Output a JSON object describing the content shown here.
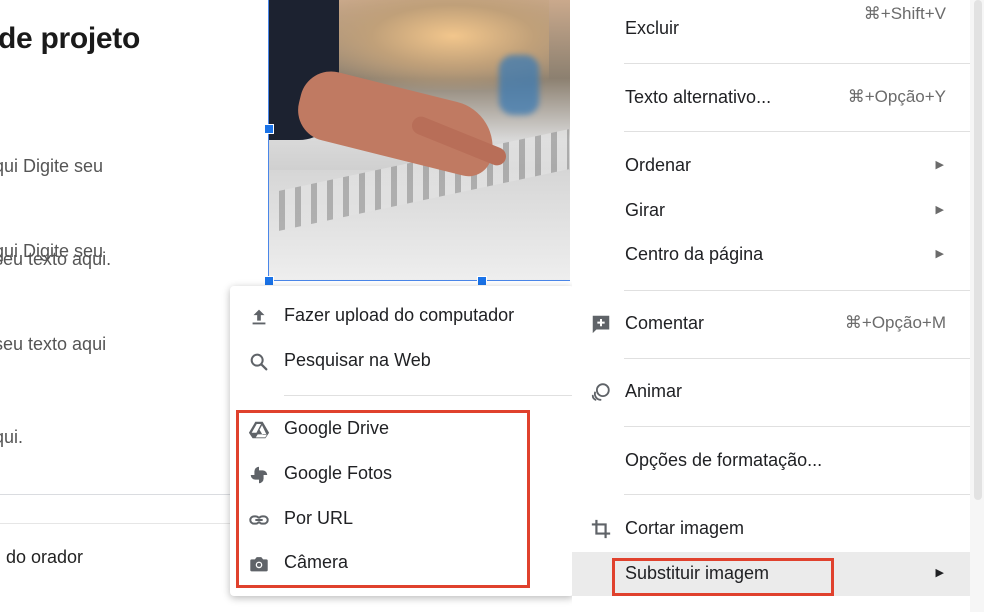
{
  "slide": {
    "title": "de projeto",
    "paragraph1": [
      "qui Digite seu",
      "seu texto aqui."
    ],
    "paragraph2": [
      "qui Digite seu",
      "seu texto aqui",
      "qui."
    ],
    "speaker_notes": "do orador"
  },
  "submenu": {
    "items": [
      {
        "label": "Fazer upload do computador",
        "icon": "upload-icon"
      },
      {
        "label": "Pesquisar na Web",
        "icon": "search-icon"
      },
      {
        "label": "Google Drive",
        "icon": "google-drive-icon"
      },
      {
        "label": "Google Fotos",
        "icon": "google-photos-icon"
      },
      {
        "label": "Por URL",
        "icon": "link-icon"
      },
      {
        "label": "Câmera",
        "icon": "camera-icon"
      }
    ]
  },
  "menu": {
    "excluir": {
      "label": "Excluir",
      "shortcut": "⌘+Shift+V"
    },
    "alt_text": {
      "label": "Texto alternativo...",
      "shortcut": "⌘+Opção+Y"
    },
    "ordenar": {
      "label": "Ordenar"
    },
    "girar": {
      "label": "Girar"
    },
    "centro": {
      "label": "Centro da página"
    },
    "comentar": {
      "label": "Comentar",
      "shortcut": "⌘+Opção+M",
      "icon": "add-comment-icon"
    },
    "animar": {
      "label": "Animar",
      "icon": "animate-icon"
    },
    "formatacao": {
      "label": "Opções de formatação..."
    },
    "cortar": {
      "label": "Cortar imagem",
      "icon": "crop-icon"
    },
    "substituir": {
      "label": "Substituir imagem"
    }
  },
  "colors": {
    "highlight_box": "#e0412d",
    "selection": "#1a73e8",
    "menu_highlight": "#ebebeb"
  }
}
